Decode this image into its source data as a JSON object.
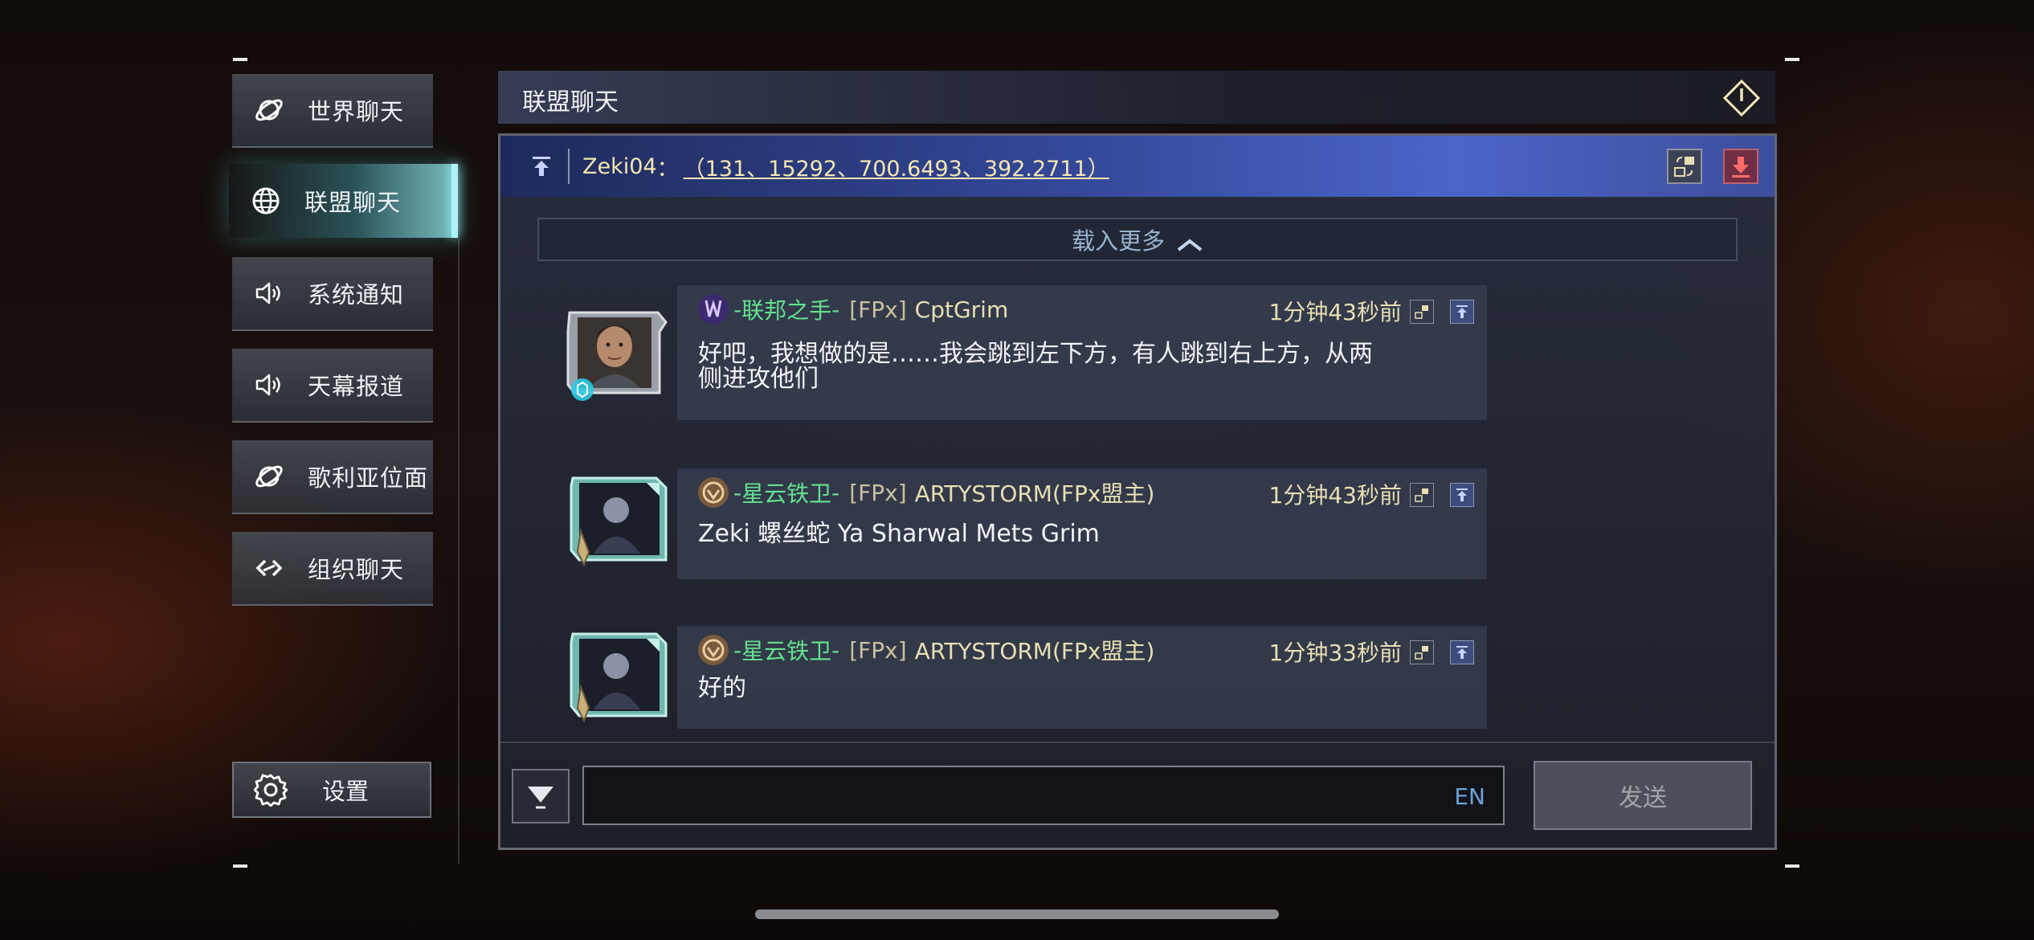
{
  "nav": {
    "items": [
      {
        "label": "世界聊天",
        "icon": "planet-icon"
      },
      {
        "label": "联盟聊天",
        "icon": "globe-icon"
      },
      {
        "label": "系统通知",
        "icon": "speaker-icon"
      },
      {
        "label": "天幕报道",
        "icon": "speaker-icon"
      },
      {
        "label": "歌利亚位面",
        "icon": "planet-icon"
      },
      {
        "label": "组织聊天",
        "icon": "link-icon"
      }
    ],
    "active_index": 1,
    "settings_label": "设置"
  },
  "header": {
    "title": "联盟聊天"
  },
  "pinned": {
    "user": "Zeki04",
    "colon": "：",
    "coords": "（131、15292、700.6493、392.2711）"
  },
  "load_more": "载入更多",
  "messages": [
    {
      "org": "联邦之手",
      "tag": "[FPx]",
      "user": "CptGrim",
      "time": "1分钟43秒前",
      "text": "好吧，我想做的是……我会跳到左下方，有人跳到右上方，从两\n侧进攻他们"
    },
    {
      "org": "星云铁卫",
      "tag": "[FPx]",
      "user": "ARTYSTORM(FPx盟主)",
      "time": "1分钟43秒前",
      "text": "Zeki 螺丝蛇 Ya Sharwal Mets Grim"
    },
    {
      "org": "星云铁卫",
      "tag": "[FPx]",
      "user": "ARTYSTORM(FPx盟主)",
      "time": "1分钟33秒前",
      "text": "好的"
    }
  ],
  "composer": {
    "placeholder": "",
    "lang": "EN",
    "send_label": "发送"
  },
  "colors": {
    "org_green": "#63e28e",
    "name_gold": "#e8dfb2",
    "pinned_blue": "#4c64c8",
    "active_cyan": "#aef3f6"
  }
}
